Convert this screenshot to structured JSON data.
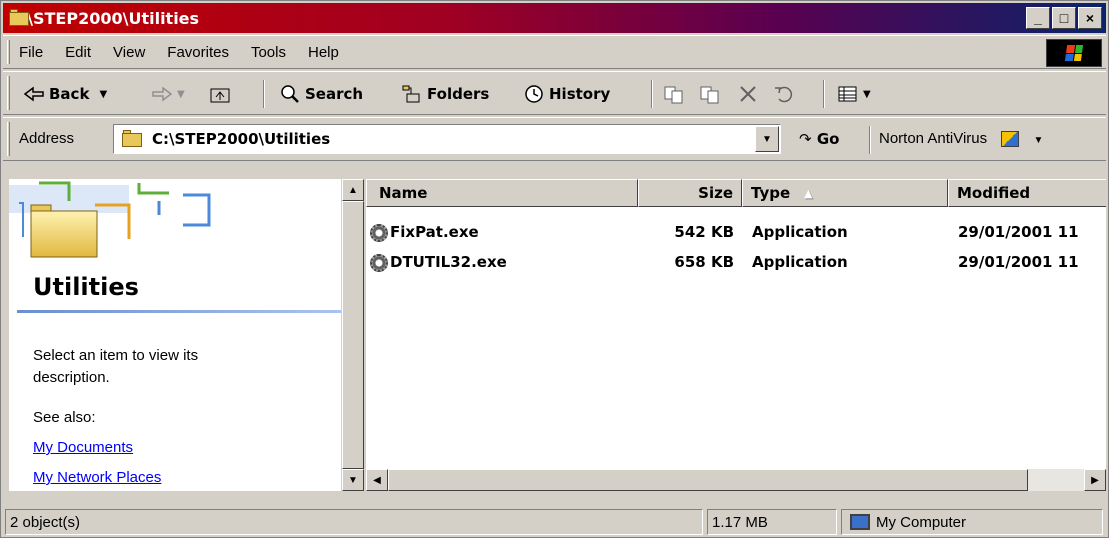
{
  "window": {
    "title": "C:\\STEP2000\\Utilities",
    "controls": {
      "minimize": "_",
      "maximize": "□",
      "close": "×"
    }
  },
  "menu": {
    "items": [
      "File",
      "Edit",
      "View",
      "Favorites",
      "Tools",
      "Help"
    ]
  },
  "toolbar": {
    "back_label": "Back",
    "search_label": "Search",
    "folders_label": "Folders",
    "history_label": "History"
  },
  "address": {
    "label": "Address",
    "value": "C:\\STEP2000\\Utilities",
    "go_label": "Go",
    "norton_label": "Norton AntiVirus"
  },
  "sidebar": {
    "folder_title": "Utilities",
    "description": "Select an item to view its description.",
    "see_also_label": "See also:",
    "links": [
      "My Documents",
      "My Network Places"
    ]
  },
  "file_list": {
    "columns": [
      "Name",
      "Size",
      "Type",
      "Modified"
    ],
    "rows": [
      {
        "name": "FixPat.exe",
        "size": "542 KB",
        "type": "Application",
        "modified": "29/01/2001 11"
      },
      {
        "name": "DTUTIL32.exe",
        "size": "658 KB",
        "type": "Application",
        "modified": "29/01/2001 11"
      }
    ]
  },
  "status": {
    "object_count": "2 object(s)",
    "total_size": "1.17 MB",
    "zone": "My Computer"
  },
  "colors": {
    "title_start": "#c00000",
    "title_end": "#0a246a",
    "face": "#d4d0c8",
    "link": "#0000ff"
  }
}
